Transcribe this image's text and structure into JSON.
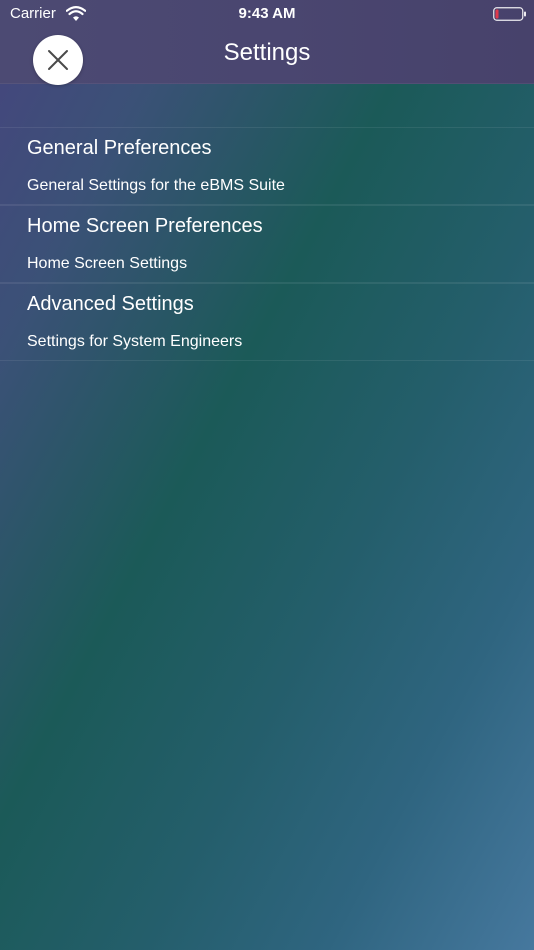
{
  "status_bar": {
    "carrier": "Carrier",
    "time": "9:43 AM",
    "wifi_icon": "wifi-icon",
    "battery_icon": "battery-low-icon"
  },
  "header": {
    "title": "Settings",
    "close_icon": "close-icon"
  },
  "sections": [
    {
      "title": "General Preferences",
      "items": [
        "General Settings for the eBMS Suite"
      ]
    },
    {
      "title": "Home Screen Preferences",
      "items": [
        "Home Screen Settings"
      ]
    },
    {
      "title": "Advanced Settings",
      "items": [
        "Settings for System Engineers"
      ]
    }
  ],
  "colors": {
    "header_bg": "#4b4871",
    "gradient_start": "#46457e",
    "gradient_mid": "#1b5a58",
    "gradient_end": "#46789e",
    "battery_low": "#e0394c"
  }
}
